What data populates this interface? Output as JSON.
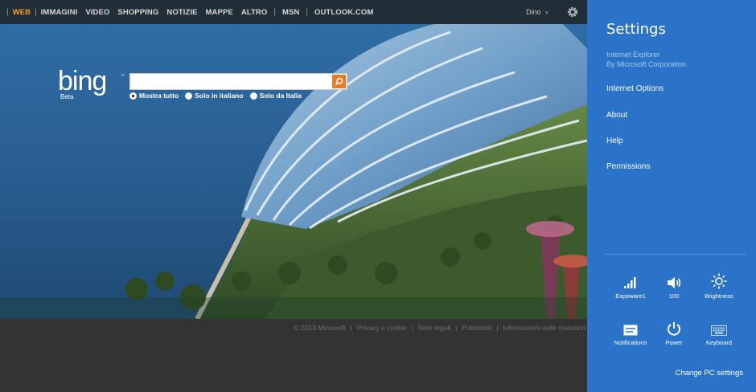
{
  "nav": {
    "items": [
      {
        "label": "WEB",
        "active": true
      },
      {
        "label": "IMMAGINI"
      },
      {
        "label": "VIDEO"
      },
      {
        "label": "SHOPPING"
      },
      {
        "label": "NOTIZIE"
      },
      {
        "label": "MAPPE"
      },
      {
        "label": "ALTRO"
      },
      {
        "label": "MSN"
      },
      {
        "label": "OUTLOOK.COM"
      }
    ],
    "user": "Dino",
    "user_caret": "▾"
  },
  "logo": {
    "text": "bing",
    "sub": "Beta"
  },
  "search": {
    "value": "",
    "placeholder": ""
  },
  "radios": [
    {
      "label": "Mostra tutto",
      "selected": true
    },
    {
      "label": "Solo in italiano",
      "selected": false
    },
    {
      "label": "Solo da Italia",
      "selected": false
    }
  ],
  "footer": {
    "copyright": "© 2013 Microsoft",
    "links": [
      "Privacy e cookie",
      "Note legali",
      "Pubblicità",
      "Informazioni sulle inserzion"
    ]
  },
  "settings": {
    "title": "Settings",
    "app_name": "Internet Explorer",
    "app_publisher": "By Microsoft Corporation",
    "items": [
      "Internet Options",
      "About",
      "Help",
      "Permissions"
    ],
    "tiles": [
      {
        "label": "Expoware1",
        "icon": "network-signal-icon"
      },
      {
        "label": "100",
        "icon": "volume-icon"
      },
      {
        "label": "Brightness",
        "icon": "brightness-icon"
      },
      {
        "label": "Notifications",
        "icon": "notifications-icon"
      },
      {
        "label": "Power",
        "icon": "power-icon"
      },
      {
        "label": "Keyboard",
        "icon": "keyboard-icon"
      }
    ],
    "change_pc": "Change PC settings"
  },
  "colors": {
    "charm_bg": "#2b73c8",
    "nav_active": "#f3a323",
    "search_button": "#f07a21"
  }
}
